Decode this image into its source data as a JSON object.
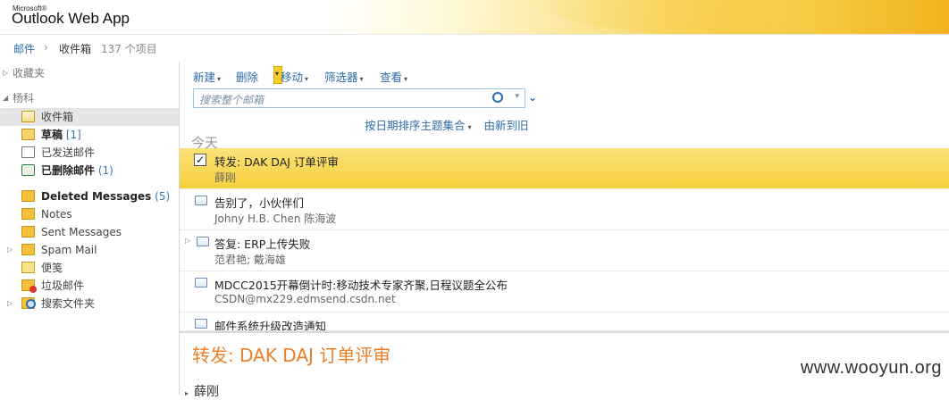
{
  "header": {
    "brand_small": "Microsoft®",
    "brand": "Outlook Web App"
  },
  "breadcrumb": {
    "root": "邮件",
    "separator": "›",
    "folder": "收件箱",
    "count": "137 个项目"
  },
  "sidebar": {
    "favorites": "收藏夹",
    "account": "杨科",
    "items": [
      {
        "label": "收件箱",
        "count": ""
      },
      {
        "label": "草稿",
        "count": "[1]"
      },
      {
        "label": "已发送邮件",
        "count": ""
      },
      {
        "label": "已删除邮件",
        "count": "(1)"
      },
      {
        "label": "Deleted Messages",
        "count": "(5)"
      },
      {
        "label": "Notes",
        "count": ""
      },
      {
        "label": "Sent Messages",
        "count": ""
      },
      {
        "label": "Spam Mail",
        "count": ""
      },
      {
        "label": "便笺",
        "count": ""
      },
      {
        "label": "垃圾邮件",
        "count": ""
      },
      {
        "label": "搜索文件夹",
        "count": ""
      }
    ]
  },
  "toolbar": {
    "new": "新建",
    "delete": "删除",
    "move": "移动",
    "filter": "筛选器",
    "view": "查看"
  },
  "search": {
    "placeholder": "搜索整个邮箱"
  },
  "sort": {
    "by": "按日期排序主题集合",
    "order": "由新到旧"
  },
  "group": {
    "today": "今天"
  },
  "messages": [
    {
      "subject": "转发: DAK DAJ 订单评审",
      "from": "薛刚"
    },
    {
      "subject": "告别了，小伙伴们",
      "from": "Johny H.B. Chen 陈海波"
    },
    {
      "subject": "答复: ERP上传失败",
      "from": "范君艳; 戴海雄"
    },
    {
      "subject": "MDCC2015开幕倒计时:移动技术专家齐聚,日程议题全公布",
      "from": "CSDN@mx229.edmsend.csdn.net"
    },
    {
      "subject": "邮件系统升级改造通知",
      "from": ""
    }
  ],
  "reading": {
    "title": "转发: DAK DAJ 订单评审",
    "sender": "薛刚"
  },
  "watermark": "www.wooyun.org",
  "colors": {
    "accent": "#2e6ba7",
    "selection": "#f6d03a",
    "reading_title": "#e8802a"
  }
}
